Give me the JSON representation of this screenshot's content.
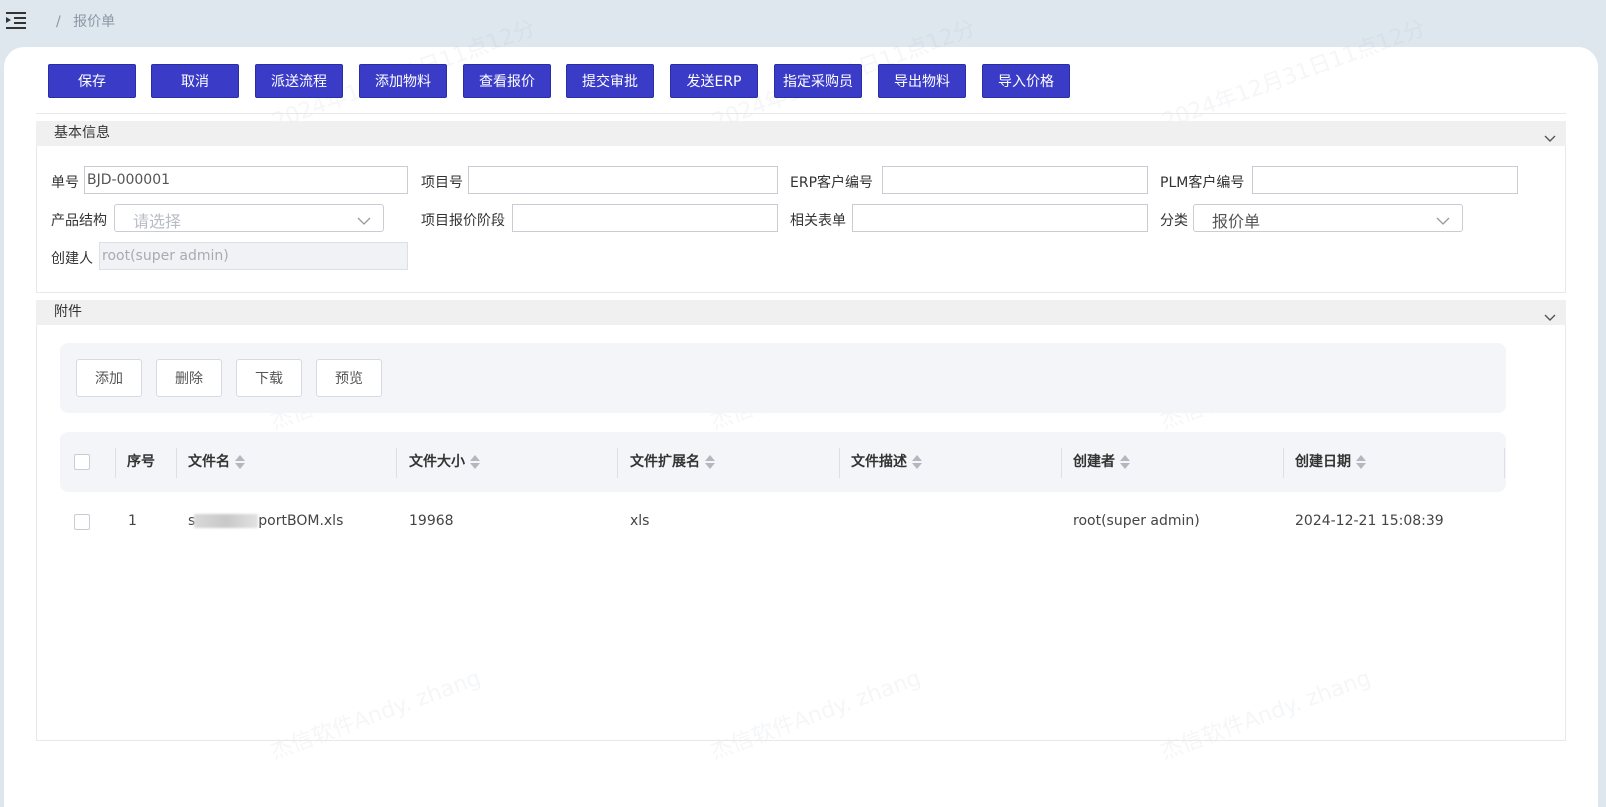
{
  "breadcrumb": {
    "separator": "/",
    "current": "报价单"
  },
  "toolbar": [
    "保存",
    "取消",
    "派送流程",
    "添加物料",
    "查看报价",
    "提交审批",
    "发送ERP",
    "指定采购员",
    "导出物料",
    "导入价格"
  ],
  "basic_info": {
    "title": "基本信息",
    "order_no_label": "单号",
    "order_no_value": "BJD-000001",
    "project_no_label": "项目号",
    "project_no_value": "",
    "erp_customer_label": "ERP客户编号",
    "erp_customer_value": "",
    "plm_customer_label": "PLM客户编号",
    "plm_customer_value": "",
    "product_structure_label": "产品结构",
    "product_structure_placeholder": "请选择",
    "quote_stage_label": "项目报价阶段",
    "quote_stage_value": "",
    "related_form_label": "相关表单",
    "related_form_value": "",
    "category_label": "分类",
    "category_value": "报价单",
    "creator_label": "创建人",
    "creator_value": "root(super admin)"
  },
  "attachments": {
    "title": "附件",
    "buttons": [
      "添加",
      "删除",
      "下载",
      "预览"
    ],
    "columns": [
      "序号",
      "文件名",
      "文件大小",
      "文件扩展名",
      "文件描述",
      "创建者",
      "创建日期"
    ],
    "rows": [
      {
        "index": "1",
        "filename_start": "s",
        "filename_end": "portBOM.xls",
        "size": "19968",
        "ext": "xls",
        "desc": "",
        "creator": "root(super admin)",
        "created": "2024-12-21 15:08:39"
      }
    ]
  },
  "watermark": {
    "line1": "2024年12月31日11点12分",
    "line2": "杰信软件Andy. zhang"
  },
  "colors": {
    "primary": "#3a3cc8",
    "background": "#dfe7ee"
  },
  "icons": [
    "menu-fold-icon",
    "chevron-down-icon",
    "sort-icon"
  ]
}
